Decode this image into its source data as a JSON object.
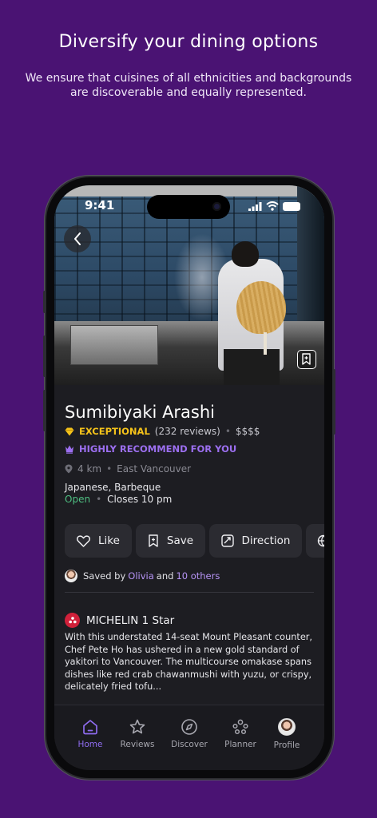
{
  "promo": {
    "headline": "Diversify your dining options",
    "subline": "We ensure that cuisines of all ethnicities and backgrounds are discoverable and equally represented."
  },
  "status_bar": {
    "time": "9:41"
  },
  "restaurant": {
    "name": "Sumibiyaki Arashi",
    "rating_label": "EXCEPTIONAL",
    "reviews": "(232 reviews)",
    "price": "$$$$",
    "recommendation": "HIGHLY RECOMMEND FOR YOU",
    "distance": "4 km",
    "area": "East Vancouver",
    "cuisine": "Japanese, Barbeque",
    "open_status": "Open",
    "closes": "Closes 10 pm"
  },
  "actions": {
    "like": "Like",
    "save": "Save",
    "direction": "Direction"
  },
  "saved_by": {
    "prefix": "Saved by",
    "user": "Olivia",
    "and": "and",
    "others": "10 others"
  },
  "michelin": {
    "title": "MICHELIN 1 Star",
    "description": "With this understated 14-seat Mount Pleasant counter, Chef Pete Ho has ushered in a new gold standard of yakitori to Vancouver. The multicourse omakase spans dishes like red crab chawanmushi with yuzu, or crispy, delicately fried tofu..."
  },
  "tabs": [
    {
      "label": "Home",
      "icon": "home-icon",
      "active": true
    },
    {
      "label": "Reviews",
      "icon": "star-icon",
      "active": false
    },
    {
      "label": "Discover",
      "icon": "compass-icon",
      "active": false
    },
    {
      "label": "Planner",
      "icon": "people-icon",
      "active": false
    },
    {
      "label": "Profile",
      "icon": "avatar",
      "active": false
    }
  ],
  "colors": {
    "background": "#4a1373",
    "accent": "#8f6cf0",
    "exceptional": "#f4c21a",
    "open": "#4fbf82",
    "michelin": "#d0203a"
  }
}
